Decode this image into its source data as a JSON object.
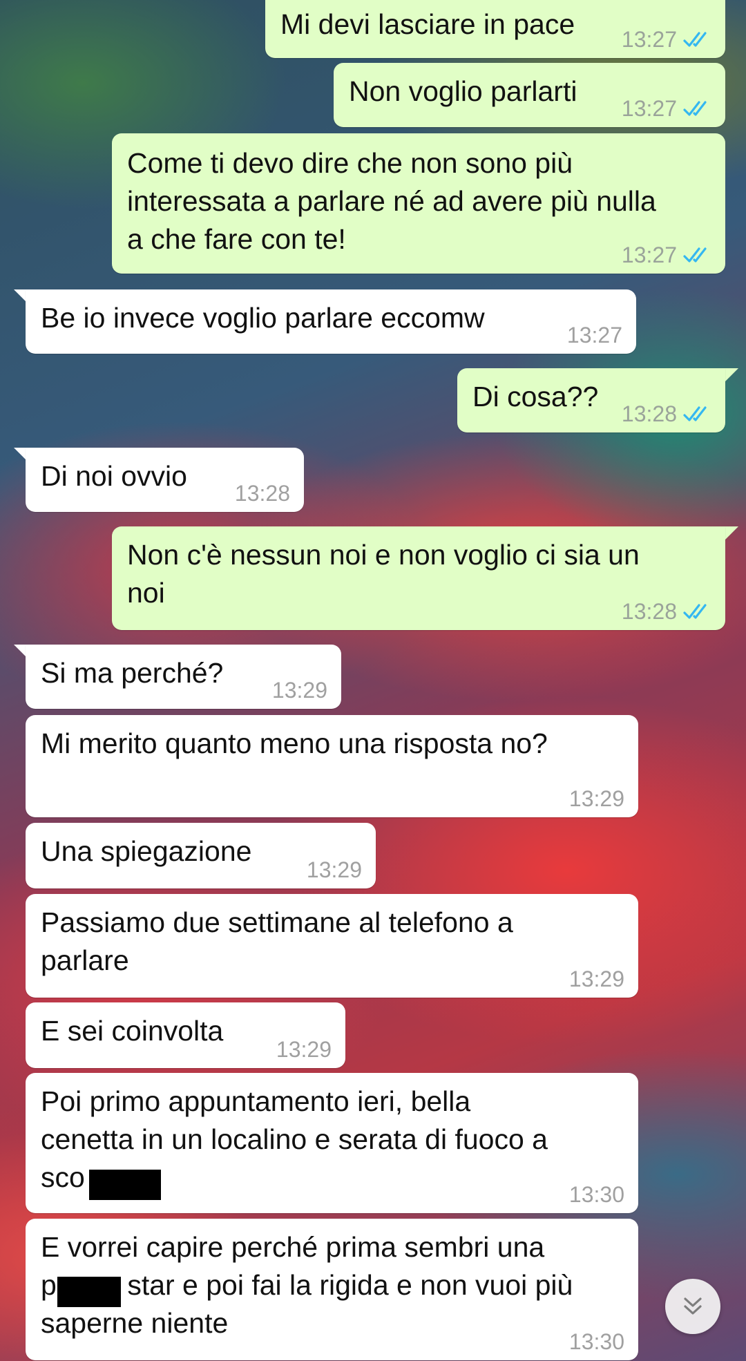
{
  "messages": [
    {
      "direction": "outgoing",
      "text": "Mi devi lasciare in pace",
      "time": "13:27",
      "status": "read"
    },
    {
      "direction": "outgoing",
      "text": "Non voglio parlarti",
      "time": "13:27",
      "status": "read"
    },
    {
      "direction": "outgoing",
      "text": "Come ti devo dire che non sono più\ninteressata a parlare né ad avere più nulla\na che fare con te!",
      "time": "13:27",
      "status": "read"
    },
    {
      "direction": "incoming",
      "text": "Be io invece voglio parlare eccomw",
      "time": "13:27"
    },
    {
      "direction": "outgoing",
      "text": "Di cosa??",
      "time": "13:28",
      "status": "read"
    },
    {
      "direction": "incoming",
      "text": "Di noi ovvio",
      "time": "13:28"
    },
    {
      "direction": "outgoing",
      "text": "Non c'è nessun noi e non voglio ci sia un\nnoi",
      "time": "13:28",
      "status": "read"
    },
    {
      "direction": "incoming",
      "text": "Si ma perché?",
      "time": "13:29"
    },
    {
      "direction": "incoming",
      "text": "Mi merito quanto meno una risposta no?",
      "time": "13:29"
    },
    {
      "direction": "incoming",
      "text": "Una spiegazione",
      "time": "13:29"
    },
    {
      "direction": "incoming",
      "text": "Passiamo due settimane al telefono a\nparlare",
      "time": "13:29"
    },
    {
      "direction": "incoming",
      "text": "E sei coinvolta",
      "time": "13:29"
    },
    {
      "direction": "incoming",
      "text": "Poi primo appuntamento ieri, bella\ncenetta in un localino e serata di fuoco a\nsco",
      "time": "13:30"
    },
    {
      "direction": "incoming",
      "text": "E vorrei capire perché prima sembri una\np         star e poi fai la rigida e non vuoi più\nsaperne niente",
      "time": "13:30"
    }
  ],
  "colors": {
    "outgoing_bubble": "#e1fec6",
    "incoming_bubble": "#ffffff",
    "read_ticks": "#34b7f1",
    "time_text": "#9aa39a"
  },
  "icons": {
    "read_receipt": "double-check-icon",
    "scroll_button": "double-chevron-down-icon"
  }
}
